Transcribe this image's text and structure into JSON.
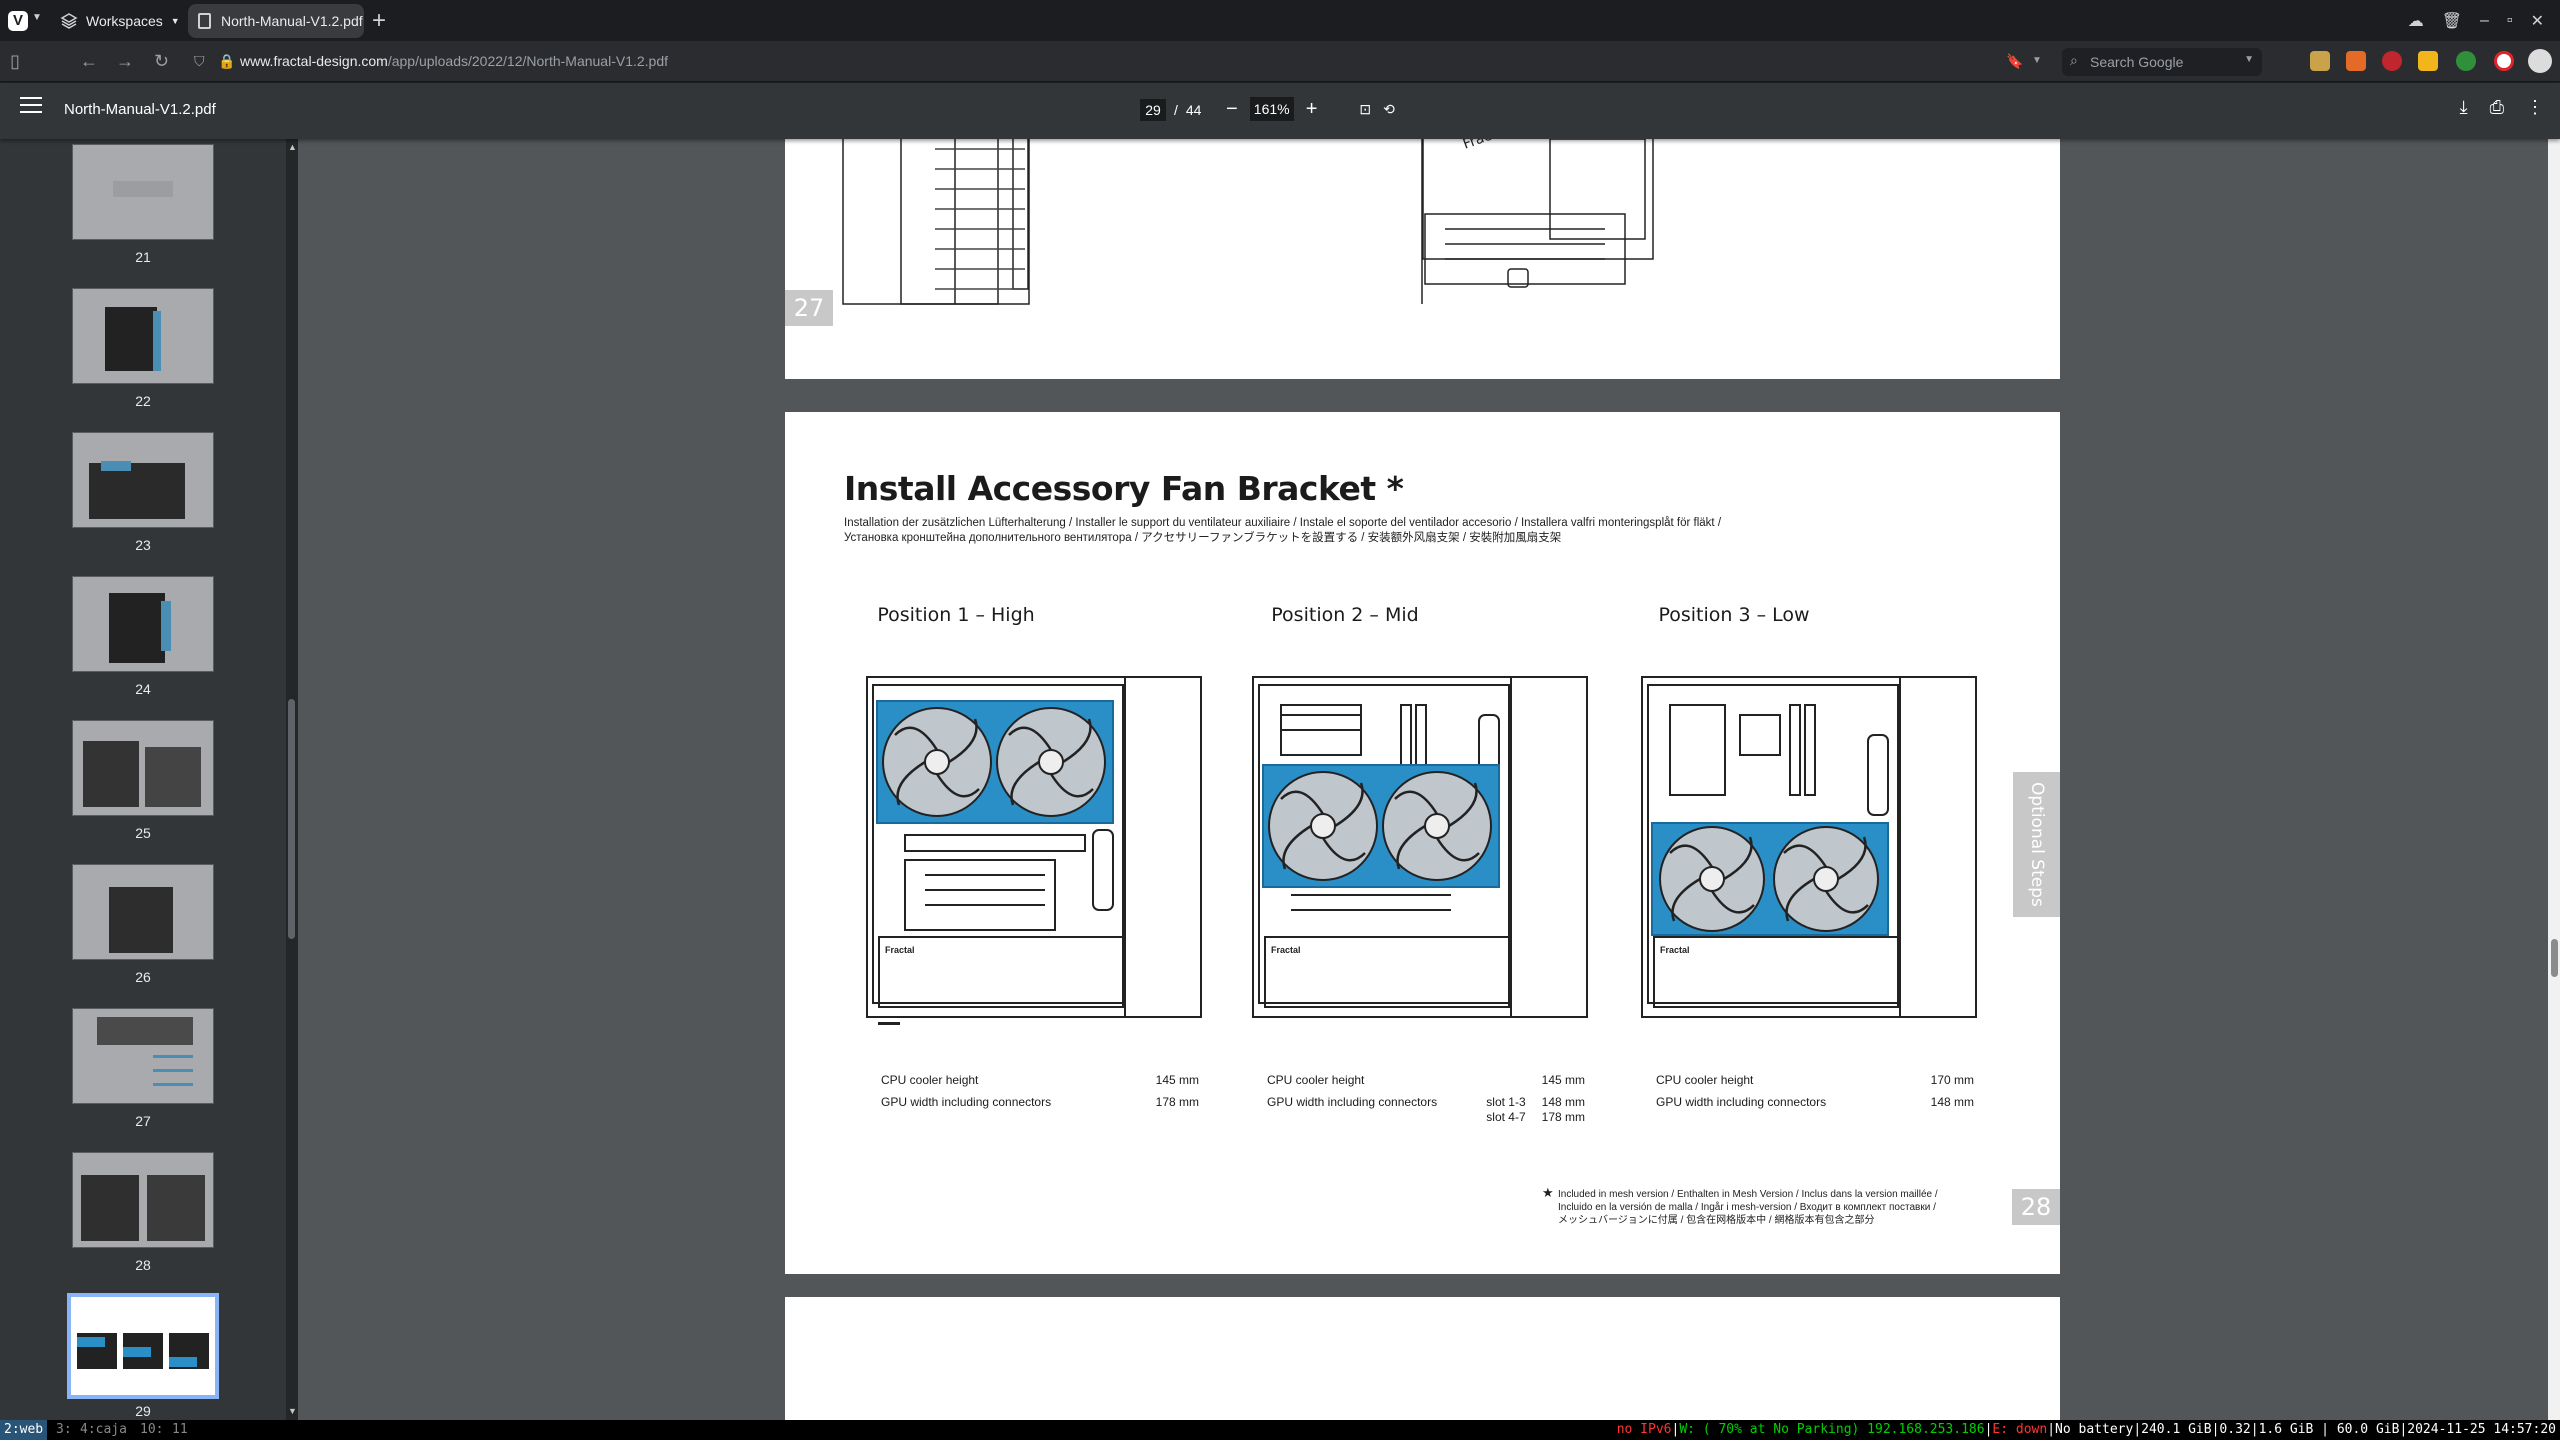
{
  "browser": {
    "workspaces_label": "Workspaces",
    "tab_title": "North-Manual-V1.2.pdf",
    "url_host": "www.fractal-design.com",
    "url_path": "/app/uploads/2022/12/North-Manual-V1.2.pdf",
    "search_placeholder": "Search Google"
  },
  "pdf_toolbar": {
    "title": "North-Manual-V1.2.pdf",
    "current_page": "29",
    "separator": "/",
    "total_pages": "44",
    "zoom": "161%"
  },
  "thumbnails": [
    {
      "num": "21"
    },
    {
      "num": "22"
    },
    {
      "num": "23"
    },
    {
      "num": "24"
    },
    {
      "num": "25"
    },
    {
      "num": "26"
    },
    {
      "num": "27"
    },
    {
      "num": "28"
    },
    {
      "num": "29"
    }
  ],
  "page_top": {
    "page_number": "27"
  },
  "page_main": {
    "title": "Install Accessory Fan Bracket *",
    "subtitle_line1": "Installation der zusätzlichen Lüfterhalterung / Installer le support du ventilateur auxiliaire / Instale el soporte del ventilador accesorio / Installera valfri monteringsplåt för fläkt /",
    "subtitle_line2": "Установка кронштейна дополнительного вентилятора / アクセサリーファンブラケットを設置する / 安装额外风扇支架 / 安裝附加風扇支架",
    "positions": [
      {
        "title": "Position 1 – High",
        "cpu_label": "CPU cooler height",
        "cpu_value": "145 mm",
        "gpu_label": "GPU width including connectors",
        "gpu_slot1": "",
        "gpu_value1": "178 mm",
        "gpu_slot2": "",
        "gpu_value2": ""
      },
      {
        "title": "Position 2 – Mid",
        "cpu_label": "CPU cooler height",
        "cpu_value": "145 mm",
        "gpu_label": "GPU width including connectors",
        "gpu_slot1": "slot 1-3",
        "gpu_value1": "148 mm",
        "gpu_slot2": "slot 4-7",
        "gpu_value2": "178 mm"
      },
      {
        "title": "Position 3 – Low",
        "cpu_label": "CPU cooler height",
        "cpu_value": "170 mm",
        "gpu_label": "GPU width including connectors",
        "gpu_slot1": "",
        "gpu_value1": "148 mm",
        "gpu_slot2": "",
        "gpu_value2": ""
      }
    ],
    "side_tab": "Optional Steps",
    "footnote_star": "★",
    "footnote_line1": "Included in mesh version / Enthalten in Mesh Version / Inclus dans la version maillée /",
    "footnote_line2": "Incluido en la versión de malla / Ingår i mesh-version / Входит в комплект поставки /",
    "footnote_line3": "メッシュバージョンに付属 / 包含在网格版本中 / 網格版本有包含之部分",
    "page_number": "28",
    "accent_color": "#2a8fc7"
  },
  "statusbar": {
    "ws1": "2:web",
    "ws2": "3:",
    "ws3": "4:caja",
    "ws4": "10:",
    "ws5": "11",
    "ipv6": "no IPv6",
    "wifi": "W: ( 70% at No Parking) 192.168.253.186",
    "eth": "E: down",
    "battery": "No battery",
    "disk": "240.1 GiB",
    "load": "0.32",
    "mem": "1.6 GiB | 60.0 GiB",
    "datetime": "2024-11-25 14:57:20"
  }
}
